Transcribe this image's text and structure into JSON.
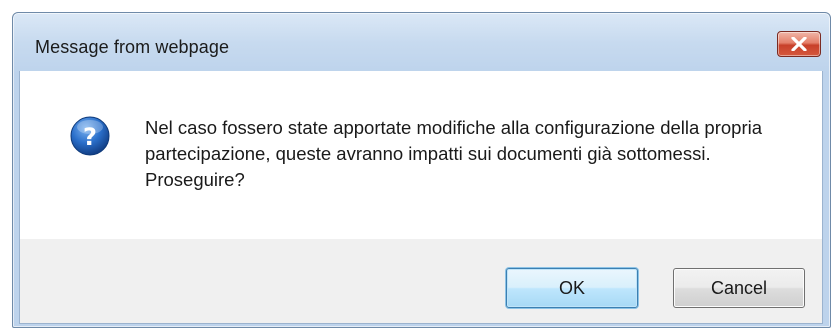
{
  "dialog": {
    "title": "Message from webpage",
    "icon": "question-icon",
    "message": "Nel caso fossero state apportate modifiche alla configurazione della propria partecipazione, queste avranno impatti sui documenti già sottomessi. Proseguire?",
    "buttons": {
      "ok_label": "OK",
      "cancel_label": "Cancel"
    },
    "close_icon": "close-icon"
  },
  "colors": {
    "title_bar": "#c7daef",
    "content_bg": "#ffffff",
    "button_bar_bg": "#f0f0f0",
    "close_button": "#c8402a",
    "icon_blue": "#1f5fb6"
  }
}
